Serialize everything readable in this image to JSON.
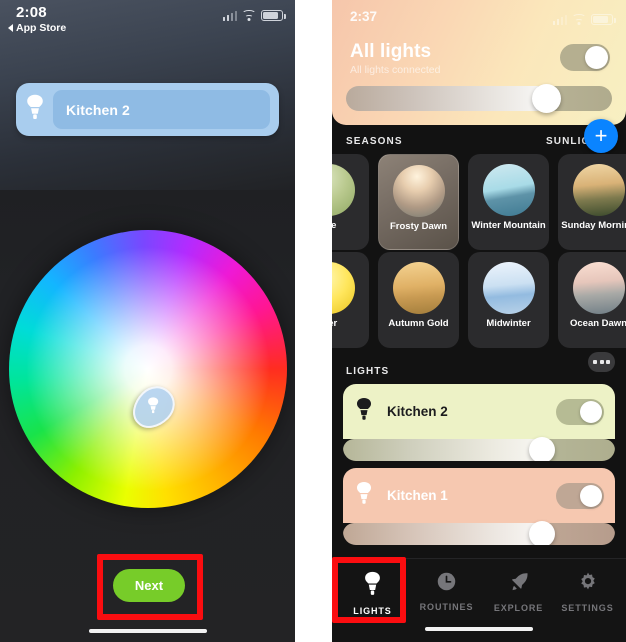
{
  "left_panel": {
    "status_bar": {
      "time": "2:08",
      "back_label": "App Store",
      "icons": [
        "signal-bars-icon",
        "wifi-icon",
        "battery-icon"
      ]
    },
    "name_card": {
      "icon": "light-bulb-icon",
      "value": "Kitchen 2",
      "placeholder": "Kitchen 2"
    },
    "color_wheel": {
      "name": "color-picker-wheel",
      "handle_icon": "light-bulb-icon"
    },
    "next_button": {
      "label": "Next",
      "color": "#77cc29"
    }
  },
  "right_panel": {
    "status_bar": {
      "time": "2:37",
      "icons": [
        "signal-bars-icon",
        "wifi-icon",
        "battery-icon"
      ]
    },
    "header": {
      "title": "All lights",
      "subtitle": "All lights connected",
      "toggle_on": true,
      "brightness_percent": 72
    },
    "sections": [
      {
        "label": "SEASONS"
      },
      {
        "label": "SUNLIGHT"
      },
      {
        "label": "LIGHTS"
      }
    ],
    "add_button": {
      "icon": "plus-icon",
      "color": "#0a84ff"
    },
    "scenes_row1": [
      {
        "name": "ake",
        "truncated": true,
        "active": false,
        "c1": "#dfe8c4",
        "c2": "#b9c98e",
        "c3": "#8fa862"
      },
      {
        "name": "Frosty Dawn",
        "truncated": false,
        "active": true,
        "c1": "#fff0d8",
        "c2": "#c4a98f",
        "c3": "#7c8078"
      },
      {
        "name": "Winter Mountain",
        "truncated": false,
        "active": false,
        "c1": "#cfe9f0",
        "c2": "#9fd4e2",
        "c3": "#5e93a8"
      },
      {
        "name": "Sunday Morning",
        "truncated": false,
        "active": false,
        "c1": "#e8c894",
        "c2": "#b59a62",
        "c3": "#4d5538"
      }
    ],
    "scenes_row2": [
      {
        "name": "mer",
        "truncated": true,
        "active": false,
        "c1": "#fff6b0",
        "c2": "#ffe75c",
        "c3": "#e8c31e"
      },
      {
        "name": "Autumn Gold",
        "truncated": false,
        "active": false,
        "c1": "#f0c878",
        "c2": "#d6a454",
        "c3": "#9c7a3a"
      },
      {
        "name": "Midwinter",
        "truncated": false,
        "active": false,
        "c1": "#e8f2fb",
        "c2": "#b6d3ec",
        "c3": "#7fa9d4"
      },
      {
        "name": "Ocean Dawn",
        "truncated": false,
        "active": false,
        "c1": "#f6dcd0",
        "c2": "#cfb8b4",
        "c3": "#8e9aa0"
      }
    ],
    "lights_menu": {
      "icon": "more-options-icon"
    },
    "lights": [
      {
        "name": "Kitchen 2",
        "icon": "light-bulb-icon",
        "card_color": "#edf2c6",
        "text_color": "#1c1c1e",
        "icon_color": "#1c1c1e",
        "toggle_color": "#b6bb94",
        "toggle_on": true,
        "brightness_percent": 73
      },
      {
        "name": "Kitchen 1",
        "icon": "light-bulb-icon",
        "card_color": "#f6c8b0",
        "text_color": "#ffffff",
        "icon_color": "#ffffff",
        "toggle_color": "#bfa795",
        "toggle_on": true,
        "brightness_percent": 73
      }
    ],
    "tabs": [
      {
        "label": "LIGHTS",
        "icon": "light-bulb-icon",
        "active": true
      },
      {
        "label": "ROUTINES",
        "icon": "clock-icon",
        "active": false
      },
      {
        "label": "EXPLORE",
        "icon": "rocket-icon",
        "active": false
      },
      {
        "label": "SETTINGS",
        "icon": "gear-icon",
        "active": false
      }
    ]
  },
  "annotations": [
    {
      "name": "highlight-next-button",
      "color": "#fb0d10"
    },
    {
      "name": "highlight-lights-tab",
      "color": "#fb0d10"
    }
  ]
}
